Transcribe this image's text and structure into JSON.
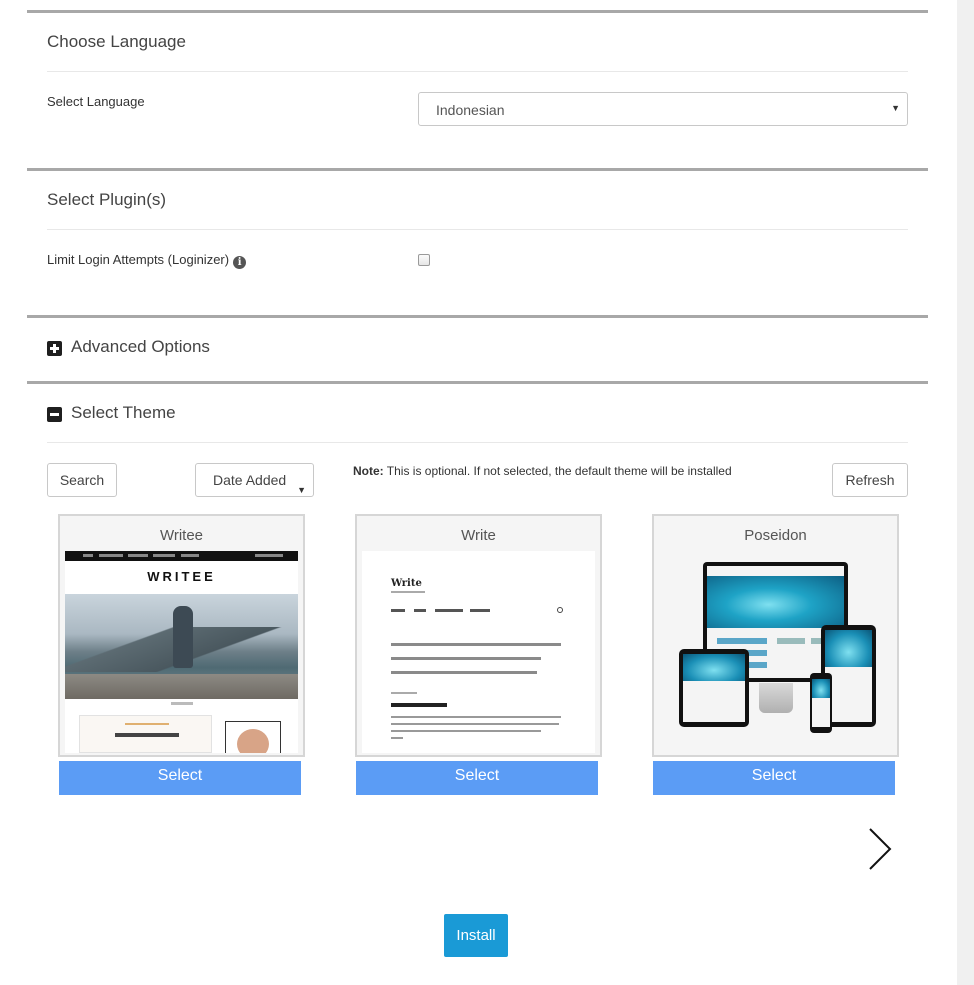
{
  "sections": {
    "language": {
      "title": "Choose Language",
      "field_label": "Select Language",
      "selected_value": "Indonesian"
    },
    "plugins": {
      "title": "Select Plugin(s)",
      "plugin_label": "Limit Login Attempts (Loginizer)",
      "checked": false
    },
    "advanced": {
      "title": "Advanced Options",
      "expanded": false
    },
    "theme": {
      "title": "Select Theme",
      "expanded": true,
      "search_label": "Search",
      "sort_value": "Date Added",
      "note_label": "Note:",
      "note_text": " This is optional. If not selected, the default theme will be installed",
      "refresh_label": "Refresh",
      "cards": [
        {
          "name": "Writee",
          "button": "Select",
          "preview_logo": "WRITEE"
        },
        {
          "name": "Write",
          "button": "Select",
          "preview_title": "Write"
        },
        {
          "name": "Poseidon",
          "button": "Select"
        }
      ]
    }
  },
  "install_label": "Install",
  "colors": {
    "select_button": "#5b9cf5",
    "install_button": "#1a9ad6",
    "section_rule": "#a8a8a8"
  }
}
